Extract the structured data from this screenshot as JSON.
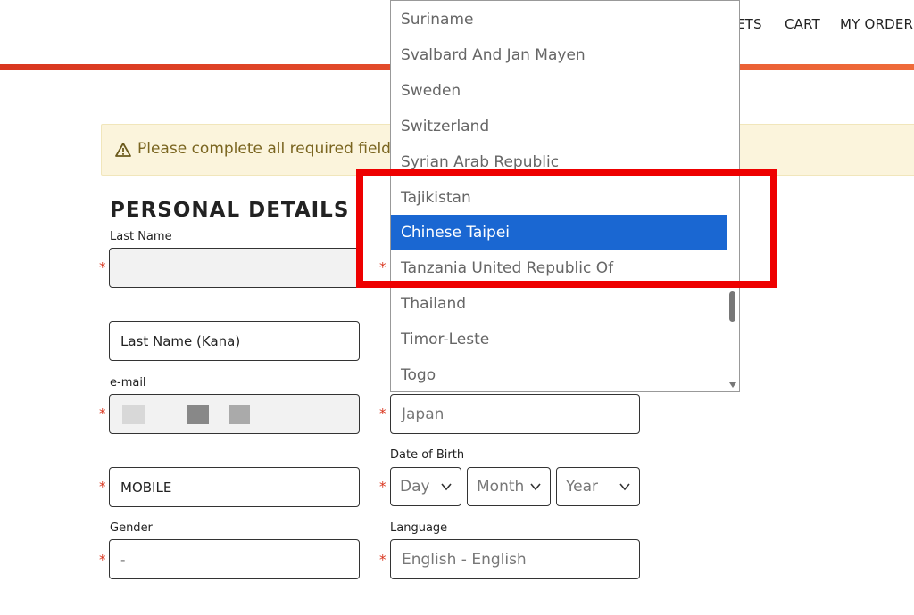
{
  "header": {
    "nav": [
      {
        "label": "ETS"
      },
      {
        "label": "CART"
      },
      {
        "label": "MY ORDERS"
      }
    ]
  },
  "alert": {
    "icon": "warning-icon",
    "text": "Please complete all required fields"
  },
  "personal": {
    "title": "PERSONAL DETAILS",
    "last_name_label": "Last Name",
    "last_name_kana_value": "Last Name (Kana)",
    "email_label": "e-mail",
    "phone_type_value": "MOBILE",
    "gender_label": "Gender",
    "gender_value": "-",
    "country_value": "Japan",
    "dob_label": "Date of Birth",
    "dob_day": "Day",
    "dob_month": "Month",
    "dob_year": "Year",
    "language_label": "Language",
    "language_value": "English - English",
    "required_mark": "*"
  },
  "country_dropdown": {
    "items": [
      "Suriname",
      "Svalbard And Jan Mayen",
      "Sweden",
      "Switzerland",
      "Syrian Arab Republic",
      "Tajikistan",
      "Chinese Taipei",
      "Tanzania United Republic Of",
      "Thailand",
      "Timor-Leste",
      "Togo"
    ],
    "selected": "Chinese Taipei"
  },
  "colors": {
    "accent_red": "#d9361f",
    "selection_blue": "#1a67d2",
    "alert_bg": "#fbf4dc",
    "highlight_red": "#ee0000"
  }
}
